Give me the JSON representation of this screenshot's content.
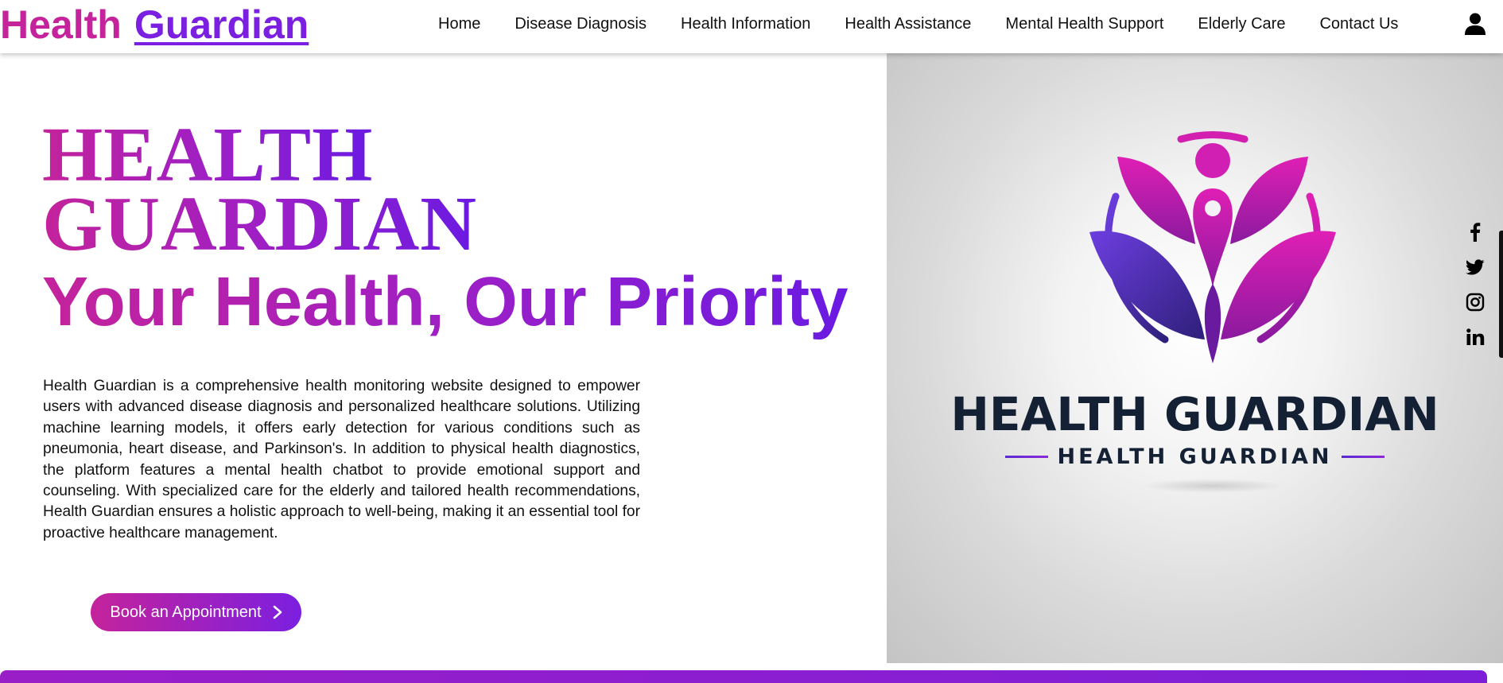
{
  "brand": {
    "health": "Health",
    "guardian": "Guardian"
  },
  "nav": {
    "items": [
      {
        "label": "Home"
      },
      {
        "label": "Disease Diagnosis"
      },
      {
        "label": "Health Information"
      },
      {
        "label": "Health Assistance"
      },
      {
        "label": "Mental Health Support"
      },
      {
        "label": "Elderly Care"
      },
      {
        "label": "Contact Us"
      }
    ],
    "account_icon": "user-icon"
  },
  "hero": {
    "title_line1": "HEALTH",
    "title_line2": "GUARDIAN",
    "tagline": "Your Health, Our Priority",
    "description": "Health Guardian is a comprehensive health monitoring website designed to empower users with advanced disease diagnosis and personalized healthcare solutions. Utilizing machine learning models, it offers early detection for various conditions such as pneumonia, heart disease, and Parkinson's. In addition to physical health diagnostics, the platform features a mental health chatbot to provide emotional support and counseling. With specialized care for the elderly and tailored health recommendations, Health Guardian ensures a holistic approach to well-being, making it an essential tool for proactive healthcare management.",
    "cta_label": "Book an Appointment",
    "cta_icon": "chevron-right-icon"
  },
  "logo": {
    "wordmark": "HEALTH GUARDIAN",
    "subtitle": "HEALTH GUARDIAN"
  },
  "social": {
    "icons": [
      "facebook-icon",
      "twitter-icon",
      "instagram-icon",
      "linkedin-icon"
    ]
  },
  "colors": {
    "brand_pink": "#c4239b",
    "brand_purple": "#7b1fe0",
    "logo_text": "#142033"
  }
}
